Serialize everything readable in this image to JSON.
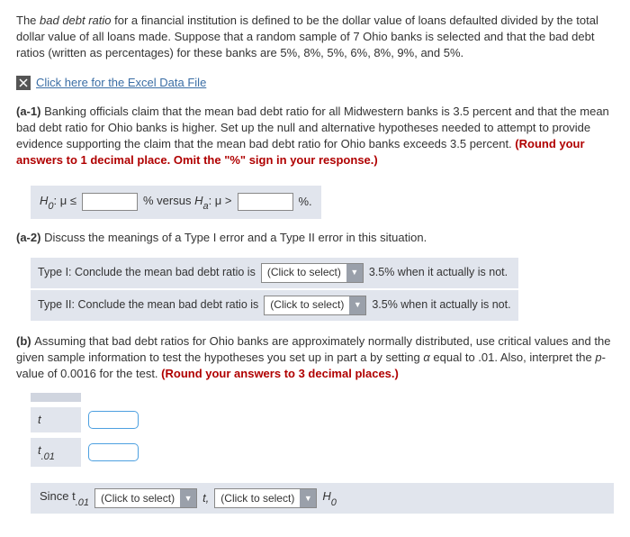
{
  "intro": {
    "p1_a": "The ",
    "p1_italic": "bad debt ratio",
    "p1_b": " for a financial institution is defined to be the dollar value of loans defaulted divided by the total dollar value of all loans made. Suppose that a random sample of 7 Ohio banks is selected and that the bad debt ratios (written as percentages) for these banks are 5%, 8%, 5%, 6%, 8%, 9%, and 5%."
  },
  "excel_link": "Click here for the Excel Data File",
  "a1": {
    "label": "(a-1) ",
    "text": "Banking officials claim that the mean bad debt ratio for all Midwestern banks is 3.5 percent and that the mean bad debt ratio for Ohio banks is higher. Set up the null and alternative hypotheses needed to attempt to provide evidence supporting the claim that the mean bad debt ratio for Ohio banks exceeds 3.5 percent. ",
    "red": "(Round your answers to 1 decimal place. Omit the \"%\" sign in your response.)",
    "h0_a": "H",
    "h0_sub": "0",
    "h0_b": ": μ ≤",
    "mid": "% versus ",
    "ha_a": "H",
    "ha_sub": "a",
    "ha_b": ": μ >",
    "end": "%."
  },
  "a2": {
    "label": "(a-2) ",
    "text": "Discuss the meanings of a Type I error and a Type II error in this situation.",
    "row1_a": "Type I:  Conclude the mean bad debt ratio is",
    "row1_b": "3.5% when it actually is not.",
    "row2_a": "Type II:  Conclude the mean bad debt ratio is",
    "row2_b": "3.5% when it actually is not.",
    "select_text": "(Click to select)"
  },
  "b": {
    "label": "(b) ",
    "text_a": "Assuming that bad debt ratios for Ohio banks are approximately normally distributed, use critical values and the given sample information to test the hypotheses you set up in part a by setting ",
    "alpha": "α",
    "text_b": " equal to .01. Also, interpret the ",
    "pval": "p",
    "text_c": "-value of 0.0016 for the test. ",
    "red": "(Round your answers to 3 decimal places.)",
    "tlabel": "t",
    "t01label": "t.01",
    "since": "Since  t",
    "since_sub": ".01",
    "t_comma": "t,",
    "h0": "H",
    "h0_sub": "0",
    "select_text": "(Click to select)"
  }
}
